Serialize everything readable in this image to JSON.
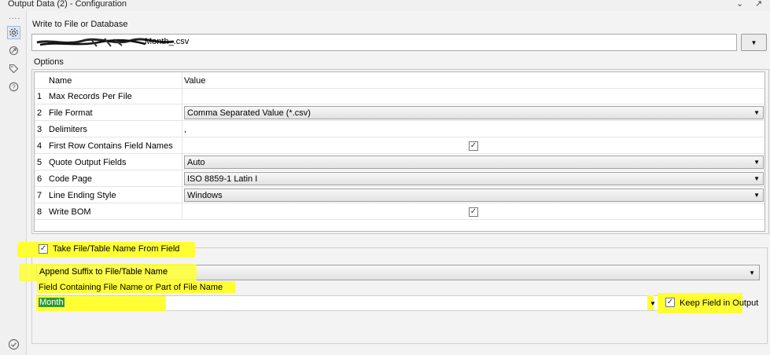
{
  "window": {
    "title": "Output Data (2) - Configuration"
  },
  "sidebar": {
    "dots": "....",
    "icons": [
      "gear-icon",
      "connection-icon",
      "tag-icon",
      "help-icon",
      "check-circle-icon"
    ]
  },
  "write_to": {
    "label": "Write to File or Database",
    "path_visible_suffix": "Month_.csv",
    "button_glyph": "▼"
  },
  "options": {
    "label": "Options",
    "headers": {
      "name": "Name",
      "value": "Value"
    },
    "rows": [
      {
        "num": "1",
        "name": "Max Records Per File",
        "value": "",
        "kind": "text"
      },
      {
        "num": "2",
        "name": "File Format",
        "value": "Comma Separated Value (*.csv)",
        "kind": "dropdown"
      },
      {
        "num": "3",
        "name": "Delimiters",
        "value": ",",
        "kind": "text"
      },
      {
        "num": "4",
        "name": "First Row Contains Field Names",
        "value": true,
        "kind": "checkbox"
      },
      {
        "num": "5",
        "name": "Quote Output Fields",
        "value": "Auto",
        "kind": "dropdown"
      },
      {
        "num": "6",
        "name": "Code Page",
        "value": "ISO 8859-1 Latin I",
        "kind": "dropdown"
      },
      {
        "num": "7",
        "name": "Line Ending Style",
        "value": "Windows",
        "kind": "dropdown"
      },
      {
        "num": "8",
        "name": "Write BOM",
        "value": true,
        "kind": "checkbox"
      }
    ]
  },
  "take_name": {
    "label": "Take File/Table Name From Field",
    "checked": true
  },
  "suffix_mode": {
    "value": "Append Suffix to File/Table Name"
  },
  "field_containing": {
    "label": "Field Containing File Name or Part of File Name",
    "value": "Month"
  },
  "keep_field": {
    "label": "Keep Field in Output",
    "checked": true
  },
  "colors": {
    "highlight": "#ffff33",
    "selection": "#2e9a2e",
    "accent": "#99b9e0"
  }
}
